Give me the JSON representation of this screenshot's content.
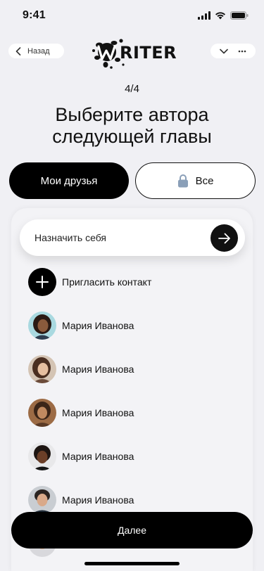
{
  "status": {
    "time": "9:41"
  },
  "header": {
    "back_label": "Назад",
    "logo_text": "WRITER"
  },
  "step": "4/4",
  "title": {
    "line1": "Выберите автора",
    "line2": "следующей главы"
  },
  "tabs": [
    {
      "label": "Мои друзья",
      "active": true
    },
    {
      "label": "Все",
      "icon": "lock-icon",
      "active": false
    }
  ],
  "assign_self": {
    "label": "Назначить себя",
    "icon": "arrow-right-icon"
  },
  "invite": {
    "label": "Пригласить контакт",
    "icon": "plus-icon"
  },
  "contacts": [
    {
      "name": "Мария Иванова"
    },
    {
      "name": "Мария Иванова"
    },
    {
      "name": "Мария Иванова"
    },
    {
      "name": "Мария Иванова"
    },
    {
      "name": "Мария Иванова"
    }
  ],
  "next_label": "Далее",
  "colors": {
    "primary": "#000000",
    "background": "#f0f0f4",
    "card": "#f3f3f6",
    "lock": "#8a9fb8"
  }
}
